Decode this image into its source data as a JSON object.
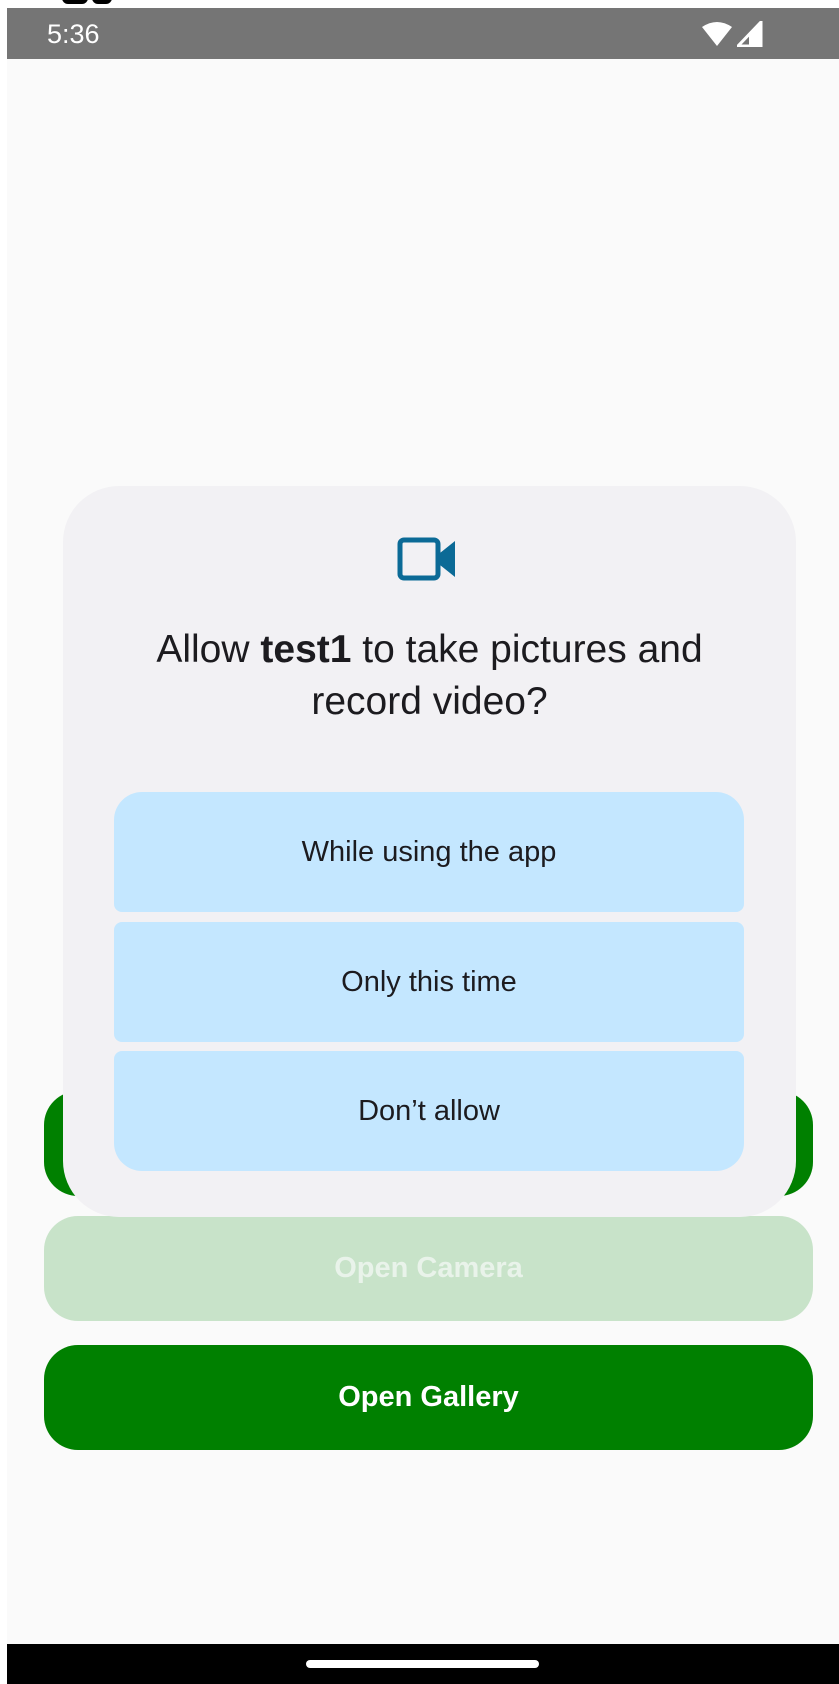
{
  "status_bar": {
    "time": "5:36",
    "icons": [
      "wifi-icon",
      "cell-signal-icon"
    ]
  },
  "buttons": {
    "hidden_label": "",
    "open_camera": "Open Camera",
    "open_gallery": "Open Gallery"
  },
  "permission_dialog": {
    "icon": "video-camera-icon",
    "title_prefix": "Allow ",
    "app_name": "test1",
    "title_suffix": " to take pictures and record video?",
    "options": [
      {
        "label": "While using the app"
      },
      {
        "label": "Only this time"
      },
      {
        "label": "Don’t allow"
      }
    ]
  },
  "colors": {
    "status_bar": "#757575",
    "primary_button": "#008000",
    "disabled_button": "#c8e3c9",
    "dialog_background": "#f2f1f4",
    "option_background": "#c4e7ff",
    "icon_accent": "#0b6a96"
  }
}
